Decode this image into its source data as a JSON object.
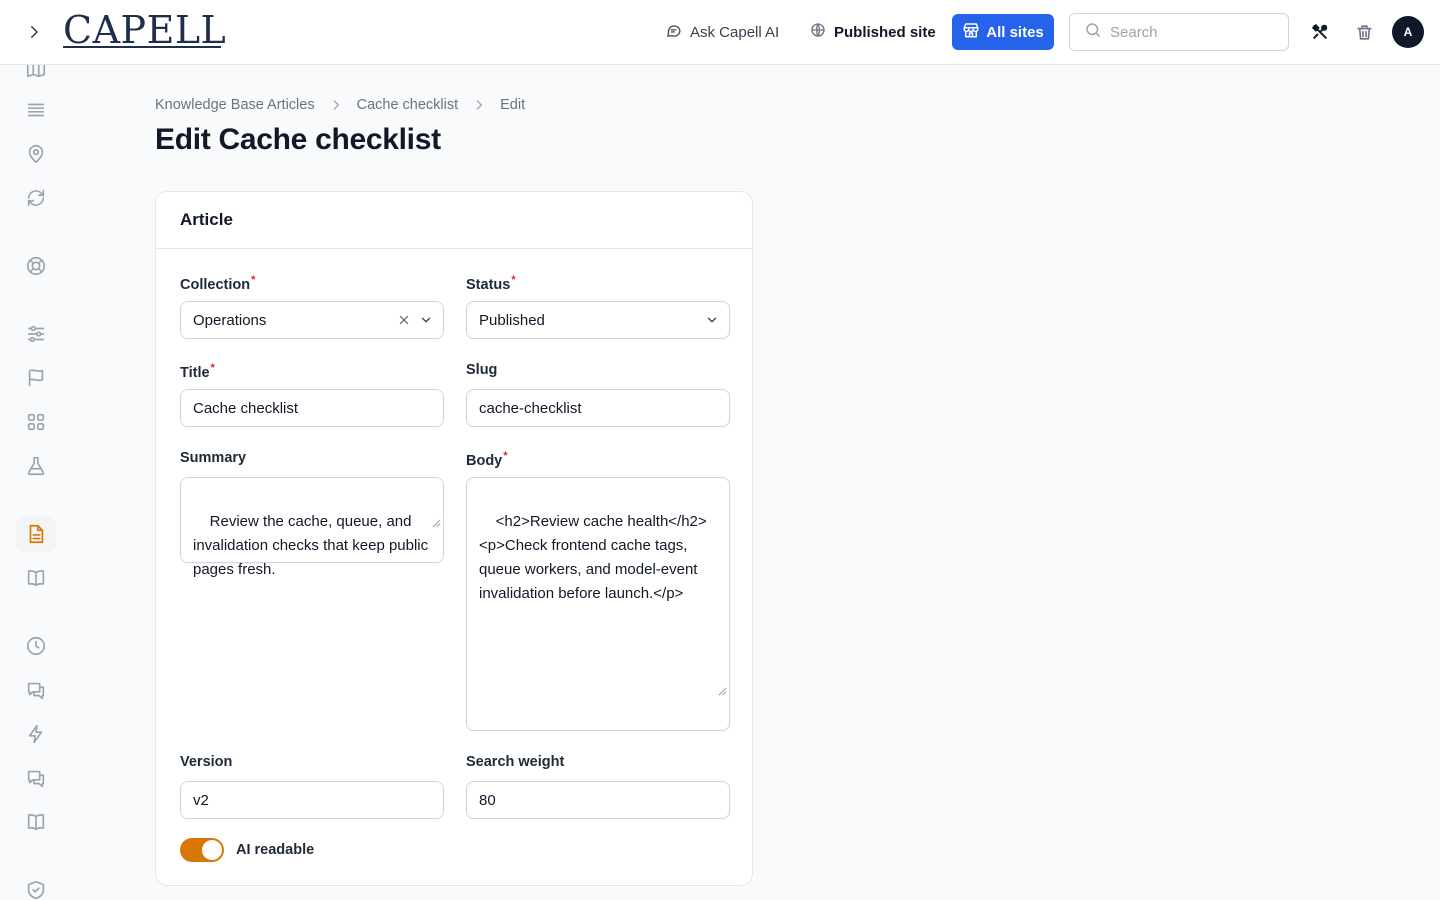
{
  "header": {
    "logo": "CAPELL",
    "ask_ai": "Ask Capell AI",
    "published_site": "Published site",
    "all_sites": "All sites",
    "search_placeholder": "Search",
    "avatar_initial": "A",
    "accent_color": "#2563eb"
  },
  "sidebar": {
    "icons": [
      "map-icon",
      "list-icon",
      "location-pin-icon",
      "sync-icon",
      "lifebuoy-icon",
      "sliders-icon",
      "flag-icon",
      "grid-icon",
      "flask-icon",
      "document-icon",
      "book-open-icon",
      "clock-icon",
      "chat-icon",
      "lightning-icon",
      "chat-alt-icon",
      "book-icon",
      "shield-check-icon"
    ],
    "active": "document-icon"
  },
  "breadcrumb": [
    "Knowledge Base Articles",
    "Cache checklist",
    "Edit"
  ],
  "page_title": "Edit Cache checklist",
  "form": {
    "section_title": "Article",
    "collection": {
      "label": "Collection",
      "value": "Operations",
      "required": true
    },
    "status": {
      "label": "Status",
      "value": "Published",
      "required": true
    },
    "title": {
      "label": "Title",
      "value": "Cache checklist",
      "required": true
    },
    "slug": {
      "label": "Slug",
      "value": "cache-checklist"
    },
    "summary": {
      "label": "Summary",
      "value": "Review the cache, queue, and invalidation checks that keep public pages fresh."
    },
    "body": {
      "label": "Body",
      "value": "<h2>Review cache health</h2><p>Check frontend cache tags, queue workers, and model-event invalidation before launch.</p>",
      "required": true
    },
    "version": {
      "label": "Version",
      "value": "v2"
    },
    "search_weight": {
      "label": "Search weight",
      "value": "80"
    },
    "ai_readable": {
      "label": "AI readable",
      "value": true,
      "color": "#d97706"
    }
  }
}
